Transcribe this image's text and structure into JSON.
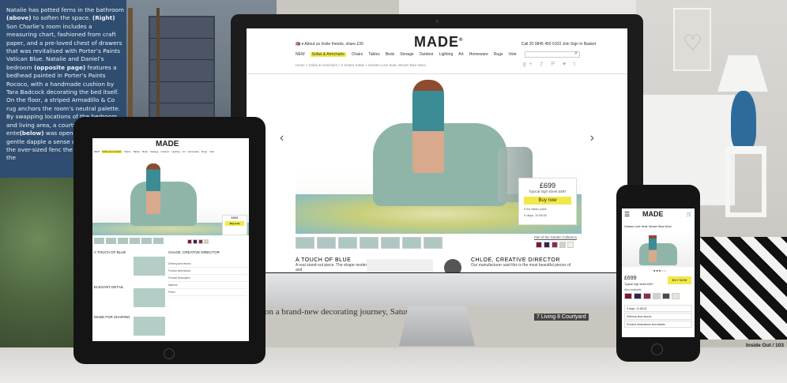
{
  "magazine": {
    "left_text": [
      {
        "t": "Natalie has potted ferns in the bathroom "
      },
      {
        "t": "(above)",
        "b": true
      },
      {
        "t": " to soften the space. "
      },
      {
        "t": "(Right)",
        "b": true
      },
      {
        "t": " Son Charlie’s room includes a measuring chart, fashioned from craft paper, and a pre-loved chest of drawers that was revitalised with Porter’s Paints Vatican Blue. Natalie and Daniel’s bedroom "
      },
      {
        "t": "(opposite page)",
        "b": true
      },
      {
        "t": " features a bedhead painted in Porter’s Paints Rococo, with a handmade cushion by Tara Badcock decorating the bed itself. On the floor, a striped Armadillo & Co rug anchors the room’s neutral palette. By swapping locations of the bedroom and living area, a courtyard ente"
      },
      {
        "t": "(below)",
        "b": true
      },
      {
        "t": " was opened up creates gentle dapple a sense of privacy, fur by the over-sized fenc the courtyard from the"
      }
    ],
    "bottom_text": "on a brand-new decorating journey, Saturday nights. ✣",
    "caption": "7 Living 8 Courtyard",
    "folio": "Inside Out / 103"
  },
  "imac": {
    "logo": "MADE",
    "logo_mark": "®",
    "top_left": "🇬🇧 ▾   About us    Invite friends, share £30",
    "top_right": "Call 20 0845 450 6103    Join    Sign in    Basket",
    "nav": [
      "NEW",
      "Sofas & Armchairs",
      "Chairs",
      "Tables",
      "Beds",
      "Storage",
      "Outdoor",
      "Lighting",
      "Art",
      "Homeware",
      "Rugs",
      "Vote"
    ],
    "nav_active": "Sofas & Armchairs",
    "breadcrumb": "Home  >  Sofas & Armchairs  >  2 Seater Sofas  >  Garden Love Seat, Woven Blue Wool",
    "social": "g+ ƒ P ♥ t",
    "search_icon": "⌕",
    "prev_arrow": "‹",
    "next_arrow": "›",
    "price": "£699",
    "high_street": "Typical high street £897",
    "buy_label": "Buy now",
    "feature_1": "Free fabric pack",
    "feature_2": "5 days, 11:58:02",
    "collection": "Part of the Garden Collection",
    "swatch_colors": [
      "#7b1a2e",
      "#33254a",
      "#8a2f49",
      "#d5cfc4",
      "#f1efe8"
    ],
    "left_heading": "A TOUCH OF BLUE",
    "left_body": "A real stand-out piece. The shape modernises a bespoke silhouette and",
    "right_heading": "CHLOE, CREATIVE DIRECTOR",
    "right_body": "Our manufacturer said this is the most beautiful pieces of"
  },
  "ipad": {
    "logo": "MADE",
    "nav": [
      "NEW",
      "Sofas & Armchairs",
      "Chairs",
      "Tables",
      "Beds",
      "Storage",
      "Outdoor",
      "Lighting",
      "Art",
      "Homeware",
      "Rugs",
      "Vote"
    ],
    "price": "£699",
    "buy_label": "Buy now",
    "swatch_colors": [
      "#7b1a2e",
      "#33254a",
      "#8a2f49",
      "#d5cfc4"
    ],
    "section_1": "A TOUCH OF BLUE",
    "section_2": "CHLOE, CREATIVE DIRECTOR",
    "section_3": "ELEGANT DETAIL",
    "section_4": "MADE FOR SHARING",
    "rows": [
      "Delivery and returns",
      "Product dimensions",
      "Product Description",
      "Material",
      "Finish"
    ]
  },
  "iphone": {
    "logo": "MADE",
    "title": "Garden Love Seat, Woven Blue Wool",
    "dots": "●●●○○",
    "price": "£699",
    "high_street": "Typical high street £897",
    "buy_label": "BUY NOW",
    "also": "Also available",
    "swatch_colors": [
      "#7b1a2e",
      "#33254a",
      "#8a2f49",
      "#d5cfc4",
      "#4a4a4a",
      "#e8e3d9"
    ],
    "rows": [
      "5 days, 11:58:02",
      "Delivery and returns",
      "Product dimensions and details"
    ]
  }
}
